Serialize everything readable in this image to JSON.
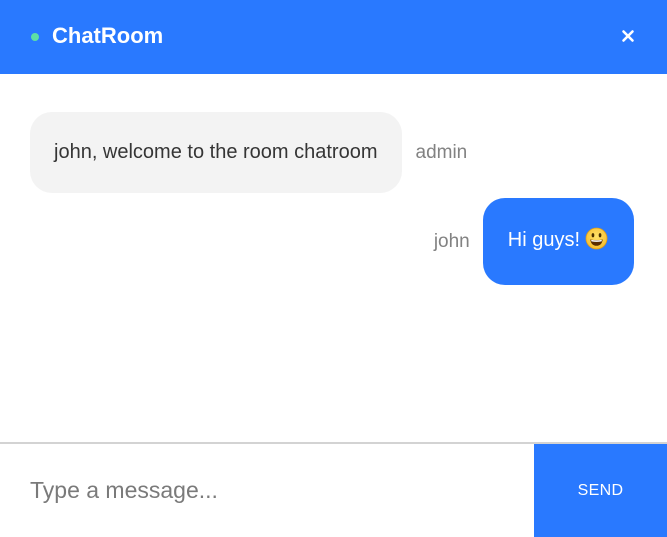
{
  "header": {
    "title": "ChatRoom",
    "status_color": "#5de0a5",
    "close_icon": "close-icon"
  },
  "messages": [
    {
      "sender": "admin",
      "text": "john, welcome to the room chatroom",
      "own": false
    },
    {
      "sender": "john",
      "text": "Hi guys!",
      "emoji": "grinning-face-emoji",
      "own": true
    }
  ],
  "composer": {
    "placeholder": "Type a message...",
    "value": "",
    "send_label": "SEND"
  },
  "colors": {
    "accent": "#2979ff",
    "other_bubble": "#f3f3f3",
    "sender_text": "#828282"
  }
}
